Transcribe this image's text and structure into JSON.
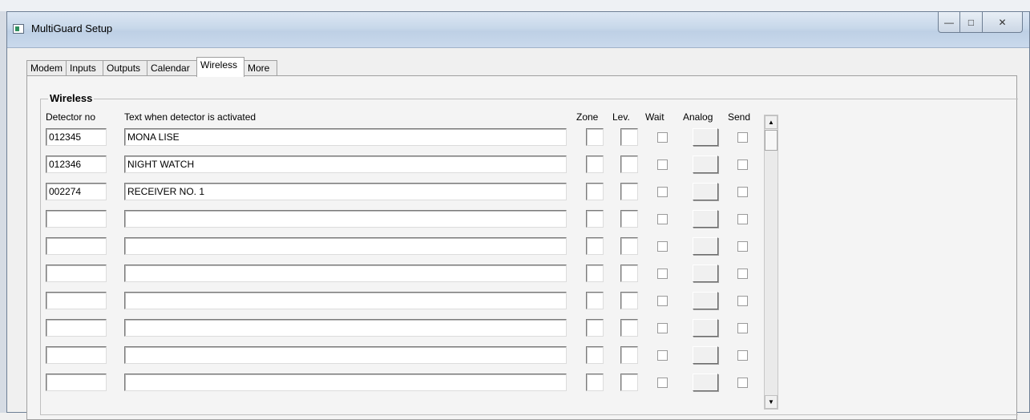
{
  "window": {
    "title": "MultiGuard Setup",
    "controls": {
      "minimize": "—",
      "maximize": "□",
      "close": "✕"
    }
  },
  "tabs": [
    {
      "label": "Modem",
      "active": false
    },
    {
      "label": "Inputs",
      "active": false
    },
    {
      "label": "Outputs",
      "active": false
    },
    {
      "label": "Calendar",
      "active": false
    },
    {
      "label": "Wireless",
      "active": true
    },
    {
      "label": "More",
      "active": false
    }
  ],
  "wireless": {
    "group_title": "Wireless",
    "headers": {
      "detector": "Detector no",
      "text": "Text when detector is activated",
      "zone": "Zone",
      "lev": "Lev.",
      "wait": "Wait",
      "analog": "Analog",
      "send": "Send"
    },
    "rows": [
      {
        "detector": "012345",
        "text": "MONA LISE",
        "zone": "",
        "lev": "",
        "wait": false,
        "send": false
      },
      {
        "detector": "012346",
        "text": "NIGHT WATCH",
        "zone": "",
        "lev": "",
        "wait": false,
        "send": false
      },
      {
        "detector": "002274",
        "text": "RECEIVER NO. 1",
        "zone": "",
        "lev": "",
        "wait": false,
        "send": false
      },
      {
        "detector": "",
        "text": "",
        "zone": "",
        "lev": "",
        "wait": false,
        "send": false
      },
      {
        "detector": "",
        "text": "",
        "zone": "",
        "lev": "",
        "wait": false,
        "send": false
      },
      {
        "detector": "",
        "text": "",
        "zone": "",
        "lev": "",
        "wait": false,
        "send": false
      },
      {
        "detector": "",
        "text": "",
        "zone": "",
        "lev": "",
        "wait": false,
        "send": false
      },
      {
        "detector": "",
        "text": "",
        "zone": "",
        "lev": "",
        "wait": false,
        "send": false
      },
      {
        "detector": "",
        "text": "",
        "zone": "",
        "lev": "",
        "wait": false,
        "send": false
      },
      {
        "detector": "",
        "text": "",
        "zone": "",
        "lev": "",
        "wait": false,
        "send": false
      }
    ]
  },
  "scrollbar": {
    "up_icon": "triangle-up",
    "down_icon": "triangle-down"
  }
}
